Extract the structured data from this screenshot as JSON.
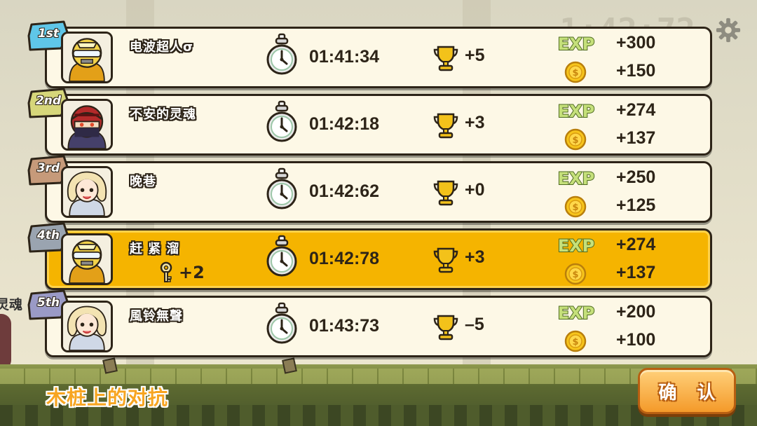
{
  "stage": {
    "name": "木桩上的对抗"
  },
  "confirm_button": {
    "label": "确 认"
  },
  "background": {
    "clock_text": "1:42:72",
    "peer_name": "灵魂"
  },
  "colors": {
    "row_bg": "#fdf8e6",
    "highlight_bg": "#f5b400",
    "accent_orange": "#f7a521",
    "outline": "#2d2418"
  },
  "results": [
    {
      "rank": "1st",
      "rank_color": "#5fc6e8",
      "name": "电波超人σ",
      "avatar": "gold-robot-avatar",
      "time": "01:41:34",
      "trophy_delta": "+5",
      "exp": "+300",
      "coins": "+150",
      "highlight": false
    },
    {
      "rank": "2nd",
      "rank_color": "#d6d67a",
      "name": "不安的灵魂",
      "avatar": "red-ninja-avatar",
      "time": "01:42:18",
      "trophy_delta": "+3",
      "exp": "+274",
      "coins": "+137",
      "highlight": false
    },
    {
      "rank": "3rd",
      "rank_color": "#c69a7a",
      "name": "晚巷",
      "avatar": "blonde-girl-avatar",
      "time": "01:42:62",
      "trophy_delta": "+0",
      "exp": "+250",
      "coins": "+125",
      "highlight": false
    },
    {
      "rank": "4th",
      "rank_color": "#9aa4b0",
      "name": "赶 紧 溜",
      "avatar": "gold-robot-avatar",
      "time": "01:42:78",
      "trophy_delta": "+3",
      "exp": "+274",
      "coins": "+137",
      "highlight": true,
      "key_bonus": "+2"
    },
    {
      "rank": "5th",
      "rank_color": "#9a9ac6",
      "name": "風铃無聲",
      "avatar": "blonde-girl-avatar",
      "time": "01:43:73",
      "trophy_delta": "–5",
      "exp": "+200",
      "coins": "+100",
      "highlight": false
    }
  ]
}
